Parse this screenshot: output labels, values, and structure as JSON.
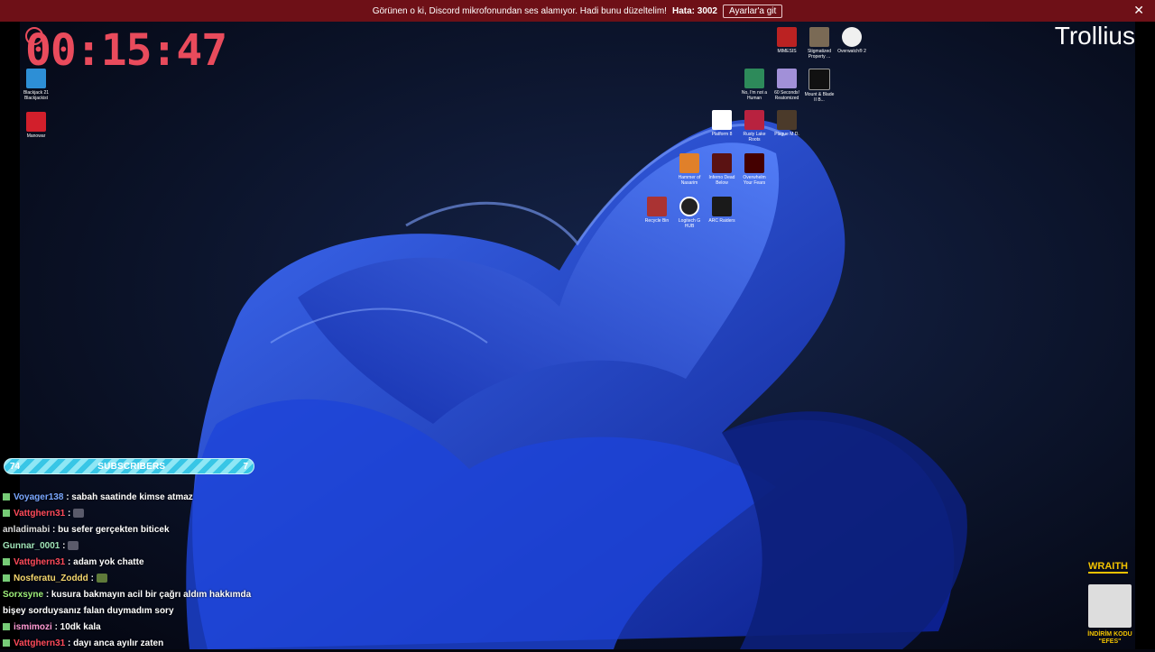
{
  "banner": {
    "message": "Görünen o ki, Discord mikrofonundan ses alamıyor. Hadi bunu düzeltelim!",
    "error": "Hata: 3002",
    "button": "Ayarlar'a git",
    "close": "✕"
  },
  "timer": "00:15:47",
  "channel": "Trollius",
  "desktop": {
    "icons": [
      {
        "label": "Blackjack 21 Blackjackist"
      },
      {
        "label": "Manowar"
      },
      {
        "label": "MIMESIS"
      },
      {
        "label": "Stigmatized Property ..."
      },
      {
        "label": "Overwatch® 2"
      },
      {
        "label": "No, I'm not a Human"
      },
      {
        "label": "60 Seconds! Reatomized"
      },
      {
        "label": "Mount & Blade II B..."
      },
      {
        "label": "Platform 8"
      },
      {
        "label": "Rusty Lake Roots"
      },
      {
        "label": "Plague M.D."
      },
      {
        "label": "Hammer of Nasarim"
      },
      {
        "label": "Inferno Dead Below"
      },
      {
        "label": "Overwhelm Your Fears"
      },
      {
        "label": "Recycle Bin"
      },
      {
        "label": "Logitech G HUB"
      },
      {
        "label": "ARC Raiders"
      }
    ]
  },
  "subscribers": {
    "left": "74",
    "label": "SUBSCRIBERS",
    "right": "7"
  },
  "chat": [
    {
      "user": "Voyager138",
      "text": ": sabah saatinde kimse atmaz"
    },
    {
      "user": "Vattghern31",
      "text": ":"
    },
    {
      "user": "anladimabi",
      "text": ": bu sefer gerçekten biticek"
    },
    {
      "user": "Gunnar_0001",
      "text": ":"
    },
    {
      "user": "Vattghern31",
      "text": ": adam yok chatte"
    },
    {
      "user": "Nosferatu_Zoddd",
      "text": ":"
    },
    {
      "user": "Sorxsyne",
      "text": ": kusura bakmayın acil bir çağrı aldım hakkımda bişey sorduysanız falan duymadım sory"
    },
    {
      "user": "ismimozi",
      "text": ": 10dk kala"
    },
    {
      "user": "Vattghern31",
      "text": ": dayı anca ayılır zaten"
    }
  ],
  "sponsor": {
    "name": "WRAITH",
    "code": "İNDİRİM KODU \"EFES\""
  },
  "colors": {
    "banner_bg": "#6e1017",
    "timer": "#e94b5c",
    "subbar": "#38c6e6",
    "sponsor": "#f2c200",
    "wallpaper_accent": "#1f4fe0"
  }
}
